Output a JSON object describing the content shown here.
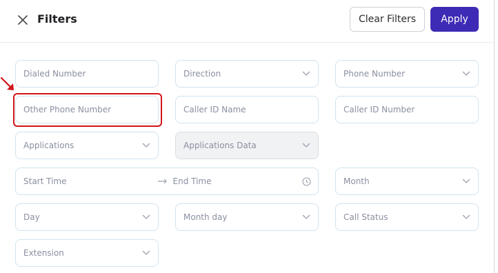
{
  "header": {
    "title": "Filters",
    "clear_label": "Clear Filters",
    "apply_label": "Apply"
  },
  "fields": {
    "dialed_number": "Dialed Number",
    "direction": "Direction",
    "phone_number": "Phone Number",
    "other_phone_number": "Other Phone Number",
    "caller_id_name": "Caller ID Name",
    "caller_id_number": "Caller ID Number",
    "applications": "Applications",
    "applications_data": "Applications Data",
    "start_time": "Start Time",
    "end_time": "End Time",
    "month": "Month",
    "day": "Day",
    "month_day": "Month day",
    "call_status": "Call Status",
    "extension": "Extension"
  },
  "colors": {
    "accent": "#3d2bb5",
    "annotation": "#d0141a",
    "field_border": "#cfe3ee",
    "placeholder": "#8a8fa0"
  },
  "icons": {
    "close": "close-icon",
    "chevron": "chevron-down-icon",
    "arrow": "arrow-right-icon",
    "clock": "clock-icon",
    "annotation_arrow": "annotation-arrow-icon"
  }
}
